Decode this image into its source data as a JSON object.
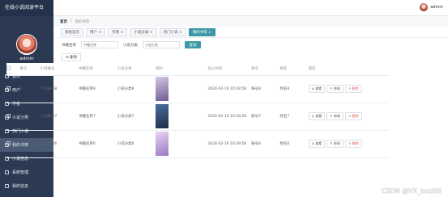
{
  "app": {
    "title": "在线小说阅读平台"
  },
  "topbar": {
    "username": "admin"
  },
  "sidebar": {
    "username": "admin",
    "items": [
      {
        "label": "首页",
        "icon": "home-icon"
      },
      {
        "label": "用户",
        "icon": "user-icon"
      },
      {
        "label": "作者",
        "icon": "author-icon"
      },
      {
        "label": "小说分类",
        "icon": "category-icon"
      },
      {
        "label": "热门小说",
        "icon": "hot-icon"
      },
      {
        "label": "我的书架",
        "icon": "bookshelf-icon",
        "active": true
      },
      {
        "label": "小说信息",
        "icon": "book-icon"
      },
      {
        "label": "系统管理",
        "icon": "settings-icon"
      },
      {
        "label": "我的信息",
        "icon": "profile-icon"
      }
    ]
  },
  "breadcrumb": {
    "home": "首页",
    "current": "我的书架"
  },
  "tabs": [
    "系统首页",
    "用户",
    "作者",
    "小说分类",
    "热门小说",
    "我的书架"
  ],
  "search": {
    "title_label": "书籍名称",
    "title_placeholder": "书籍名称",
    "category_label": "小说分类",
    "category_placeholder": "小说分类",
    "button": "查询"
  },
  "actions": {
    "delete": "删除"
  },
  "table": {
    "columns": [
      "索引",
      "小说编号",
      "书籍名称",
      "小说分类",
      "图片",
      "加入时间",
      "账号",
      "姓名",
      "操作"
    ],
    "row_buttons": {
      "view": "查看",
      "edit": "修改",
      "delete": "删除"
    },
    "rows": [
      {
        "index": "1",
        "code": "小说编号8",
        "title": "书籍名称8",
        "category": "小说分类8",
        "time": "2024-02-19 10:28:58",
        "account": "账号8",
        "name": "姓名8",
        "cover": [
          "#d9c8e8",
          "#6d5b8f"
        ]
      },
      {
        "index": "2",
        "code": "小说编号7",
        "title": "书籍名称7",
        "category": "小说分类7",
        "time": "2024-02-19 10:28:58",
        "account": "账号7",
        "name": "姓名7",
        "cover": [
          "#4a6fa0",
          "#1f2c45"
        ]
      },
      {
        "index": "3",
        "code": "小说编号6",
        "title": "书籍名称6",
        "category": "小说分类6",
        "time": "2024-02-19 10:28:58",
        "account": "账号6",
        "name": "姓名6",
        "cover": [
          "#e6d4f2",
          "#9a7bc0"
        ]
      }
    ]
  },
  "watermark": "CSDN @VX_bszj66",
  "colors": {
    "sidebar": "#2b3a52",
    "accent": "#3d97a6"
  }
}
